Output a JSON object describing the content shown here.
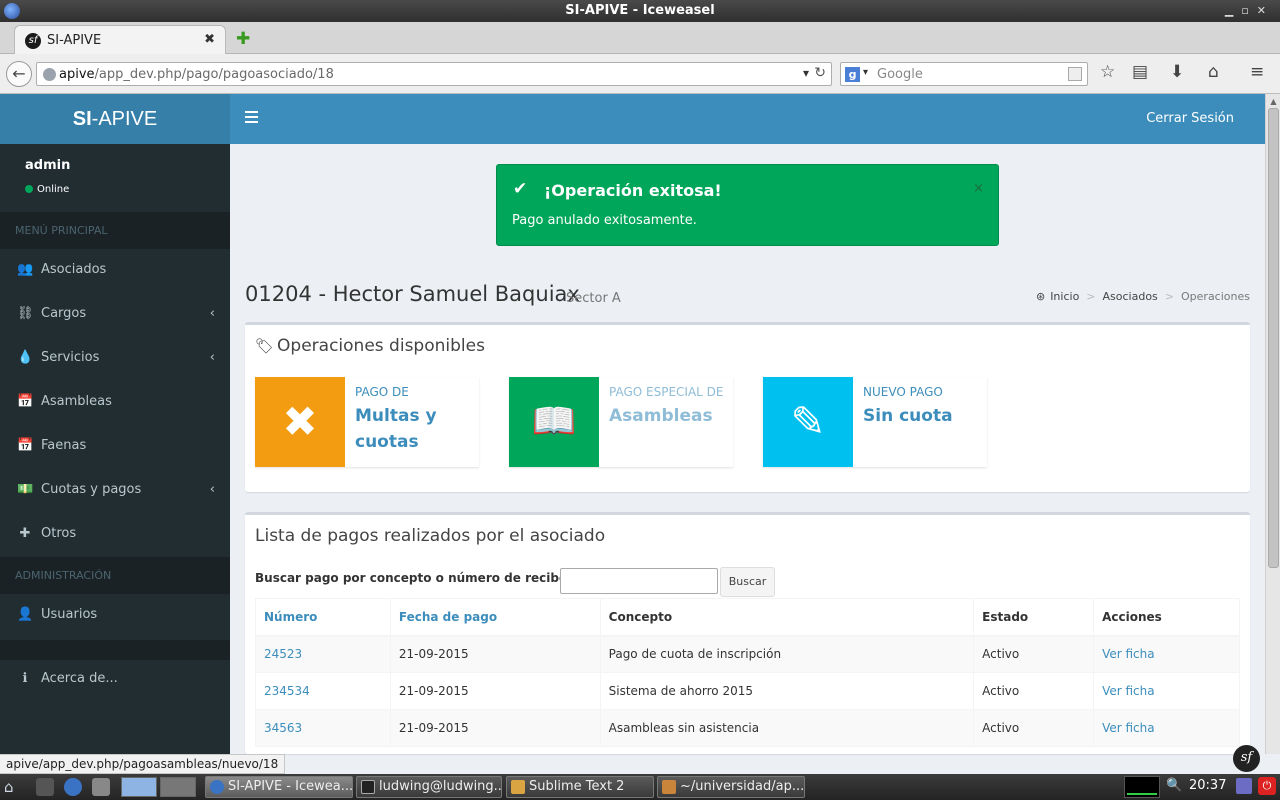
{
  "window": {
    "title": "SI-APIVE - Iceweasel"
  },
  "browser": {
    "tab_title": "SI-APIVE",
    "url_host": "apive",
    "url_path": "/app_dev.php/pago/pagoasociado/18",
    "search_placeholder": "Google",
    "status_url": "apive/app_dev.php/pagoasambleas/nuevo/18"
  },
  "app": {
    "logo_bold": "SI",
    "logo_rest": "-APIVE",
    "logout_label": "Cerrar Sesión",
    "colors": {
      "header": "#3c8dbc",
      "sidebar": "#222d32",
      "success": "#00a65a",
      "warning": "#f39c12",
      "aqua": "#00c0ef"
    }
  },
  "sidebar": {
    "user_name": "admin",
    "user_status": "Online",
    "main_header": "MENÚ PRINCIPAL",
    "items": [
      {
        "label": "Asociados",
        "icon": "users-icon",
        "glyph": "👥"
      },
      {
        "label": "Cargos",
        "icon": "sitemap-icon",
        "glyph": "⛓",
        "caret": "‹"
      },
      {
        "label": "Servicios",
        "icon": "tint-icon",
        "glyph": "💧",
        "caret": "‹"
      },
      {
        "label": "Asambleas",
        "icon": "calendar-icon",
        "glyph": "📅"
      },
      {
        "label": "Faenas",
        "icon": "calendar-icon",
        "glyph": "📅"
      },
      {
        "label": "Cuotas y pagos",
        "icon": "money-icon",
        "glyph": "💵",
        "caret": "‹"
      },
      {
        "label": "Otros",
        "icon": "plus-icon",
        "glyph": "✚"
      }
    ],
    "admin_header": "ADMINISTRACIÓN",
    "admin_items": [
      {
        "label": "Usuarios",
        "icon": "user-icon",
        "glyph": "👤"
      }
    ],
    "footer_items": [
      {
        "label": "Acerca de...",
        "icon": "info-icon",
        "glyph": "ℹ"
      }
    ]
  },
  "alert": {
    "title": "¡Operación exitosa!",
    "message": "Pago anulado exitosamente.",
    "close": "×"
  },
  "page": {
    "title": "01204 - Hector Samuel Baquiax",
    "subtitle": "Sector A",
    "breadcrumb": [
      "Inicio",
      "Asociados",
      "Operaciones"
    ]
  },
  "operations": {
    "title": "Operaciones disponibles",
    "cards": [
      {
        "label": "PAGO DE",
        "value": "Multas y cuotas",
        "icon": "times-icon",
        "glyph": "✖",
        "color": "#f39c12"
      },
      {
        "label": "PAGO ESPECIAL DE",
        "value": "Asambleas",
        "icon": "book-icon",
        "glyph": "📖",
        "color": "#00a65a"
      },
      {
        "label": "NUEVO PAGO",
        "value": "Sin cuota",
        "icon": "edit-icon",
        "glyph": "✎",
        "color": "#00c0ef"
      }
    ]
  },
  "payments": {
    "title": "Lista de pagos realizados por el asociado",
    "search_label": "Buscar pago por concepto o número de recibo:",
    "search_value": "",
    "search_button": "Buscar",
    "columns": [
      "Número",
      "Fecha de pago",
      "Concepto",
      "Estado",
      "Acciones"
    ],
    "rows": [
      {
        "numero": "24523",
        "fecha": "21-09-2015",
        "concepto": "Pago de cuota de inscripción",
        "estado": "Activo",
        "accion": "Ver ficha"
      },
      {
        "numero": "234534",
        "fecha": "21-09-2015",
        "concepto": "Sistema de ahorro 2015",
        "estado": "Activo",
        "accion": "Ver ficha"
      },
      {
        "numero": "34563",
        "fecha": "21-09-2015",
        "concepto": "Asambleas sin asistencia",
        "estado": "Activo",
        "accion": "Ver ficha"
      }
    ]
  },
  "taskbar": {
    "tasks": [
      {
        "label": "SI-APIVE - Icewea...",
        "active": true
      },
      {
        "label": "ludwing@ludwing...",
        "active": false
      },
      {
        "label": "Sublime Text 2",
        "active": false
      },
      {
        "label": "~/universidad/ap...",
        "active": false
      }
    ],
    "clock": "20:37"
  }
}
